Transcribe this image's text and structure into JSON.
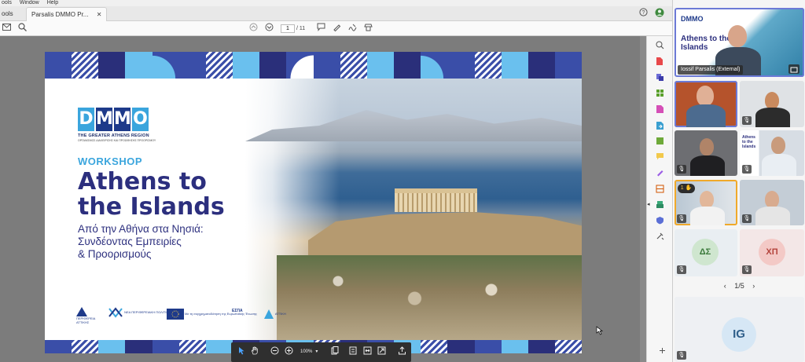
{
  "menu": {
    "items": [
      "ools",
      "Window",
      "Help"
    ]
  },
  "tabs": {
    "partial_label": "ools",
    "active_label": "Parsalis DMMO Pr...",
    "close": "✕"
  },
  "toolbar": {
    "page_current": "1",
    "page_total": "/ 11"
  },
  "slide": {
    "logo_letters": [
      "D",
      "M",
      "M",
      "O"
    ],
    "logo_region": "THE GREATER ATHENS REGION",
    "logo_tagline": "ΟΡΓΑΝΙΣΜΟΣ ΔΙΑΧΕΙΡΙΣΗΣ ΚΑΙ ΠΡΟΩΘΗΣΗΣ ΠΡΟΟΡΙΣΜΟΥ",
    "kicker": "WORKSHOP",
    "title_line1": "Athens to",
    "title_line2": "the Islands",
    "subtitle_line1": "Από την Αθήνα στα Νησιά:",
    "subtitle_line2": "Συνδέοντας Εμπειρίες",
    "subtitle_line3": "& Προορισμούς",
    "sponsors": [
      "ΠΕΡΙΦΕΡΕΙΑ ΑΤΤΙΚΗΣ",
      "ΝΕΑ ΠΕΡΙΦΕΡΕΙΑΚΗ ΠΟΛΙΤΙΚΗ",
      "Με τη συγχρηματοδότηση της Ευρωπαϊκής Ένωσης",
      "ΕΣΠΑ",
      "ΑΤΤΙΚΗ"
    ],
    "band_colors": [
      "#3a4ea8",
      "#6ac0ee",
      "#2a2f7a",
      "#ffffff"
    ]
  },
  "float_toolbar": {
    "zoom": "100%"
  },
  "meeting": {
    "presenter_name": "Iossif Parsalis (External)",
    "presenter_slide_title": "Athens to the Islands",
    "hand_count": "1",
    "initials": [
      "ΔΣ",
      "ΧΠ",
      "IG"
    ],
    "pager": "1/5",
    "pager_prev": "‹",
    "pager_next": "›"
  }
}
